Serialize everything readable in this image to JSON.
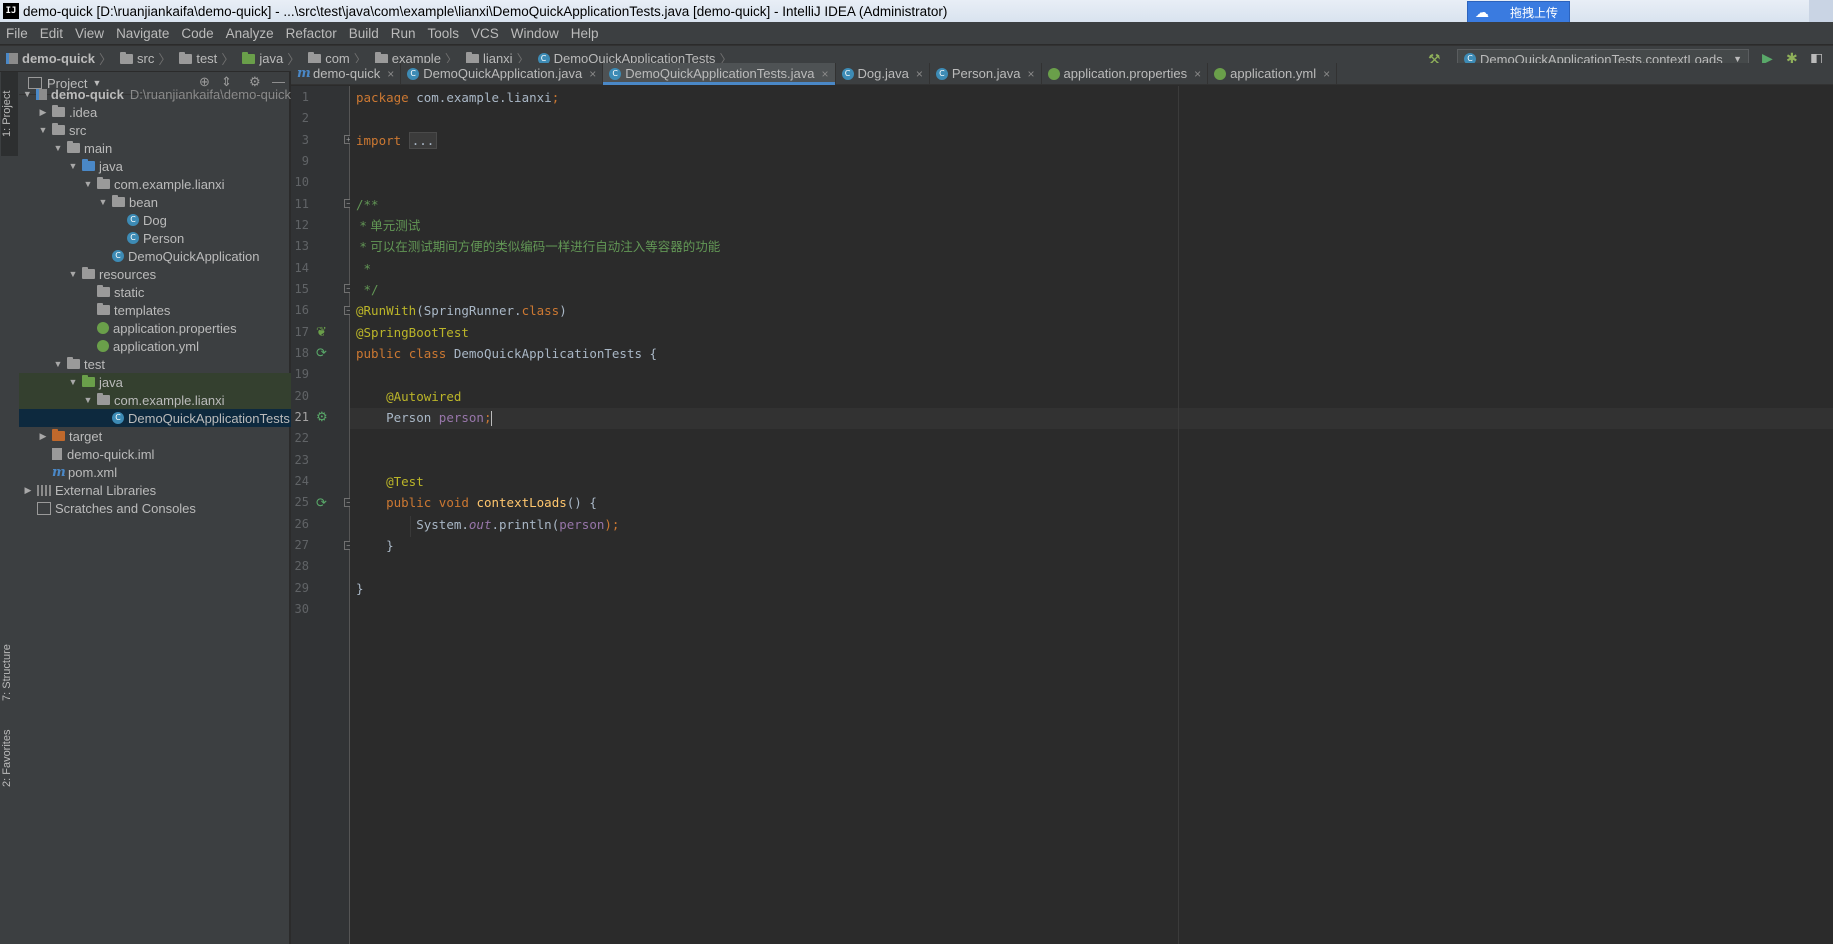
{
  "window": {
    "title": "demo-quick [D:\\ruanjiankaifa\\demo-quick] - ...\\src\\test\\java\\com\\example\\lianxi\\DemoQuickApplicationTests.java [demo-quick] - IntelliJ IDEA (Administrator)",
    "app_icon": "IJ",
    "upload_button": "拖拽上传"
  },
  "menu": [
    "File",
    "Edit",
    "View",
    "Navigate",
    "Code",
    "Analyze",
    "Refactor",
    "Build",
    "Run",
    "Tools",
    "VCS",
    "Window",
    "Help"
  ],
  "breadcrumb": [
    "demo-quick",
    "src",
    "test",
    "java",
    "com",
    "example",
    "lianxi",
    "DemoQuickApplicationTests"
  ],
  "run_config": "DemoQuickApplicationTests.contextLoads",
  "side_tabs": {
    "project": "1: Project",
    "structure": "7: Structure",
    "favorites": "2: Favorites"
  },
  "project_panel": {
    "title": "Project",
    "tree": [
      {
        "label": "demo-quick",
        "hint": "D:\\ruanjiankaifa\\demo-quick"
      },
      {
        "label": ".idea"
      },
      {
        "label": "src"
      },
      {
        "label": "main"
      },
      {
        "label": "java"
      },
      {
        "label": "com.example.lianxi"
      },
      {
        "label": "bean"
      },
      {
        "label": "Dog"
      },
      {
        "label": "Person"
      },
      {
        "label": "DemoQuickApplication"
      },
      {
        "label": "resources"
      },
      {
        "label": "static"
      },
      {
        "label": "templates"
      },
      {
        "label": "application.properties"
      },
      {
        "label": "application.yml"
      },
      {
        "label": "test"
      },
      {
        "label": "java"
      },
      {
        "label": "com.example.lianxi"
      },
      {
        "label": "DemoQuickApplicationTests"
      },
      {
        "label": "target"
      },
      {
        "label": "demo-quick.iml"
      },
      {
        "label": "pom.xml"
      },
      {
        "label": "External Libraries"
      },
      {
        "label": "Scratches and Consoles"
      }
    ]
  },
  "tabs": [
    {
      "label": "demo-quick",
      "active": false
    },
    {
      "label": "DemoQuickApplication.java",
      "active": false
    },
    {
      "label": "DemoQuickApplicationTests.java",
      "active": true
    },
    {
      "label": "Dog.java",
      "active": false
    },
    {
      "label": "Person.java",
      "active": false
    },
    {
      "label": "application.properties",
      "active": false
    },
    {
      "label": "application.yml",
      "active": false
    }
  ],
  "tab_close_glyph": "×",
  "code": {
    "line_numbers": [
      "1",
      "2",
      "3",
      "9",
      "10",
      "11",
      "12",
      "13",
      "14",
      "15",
      "16",
      "17",
      "18",
      "19",
      "20",
      "21",
      "22",
      "23",
      "24",
      "25",
      "26",
      "27",
      "28",
      "29",
      "30"
    ],
    "pkg_kw": "package",
    "pkg_name": " com.example.lianxi",
    "semi": ";",
    "import_kw": "import",
    "import_folded": "...",
    "doc_open": "/**",
    "doc_line1": " * 单元测试",
    "doc_line2": " * 可以在测试期间方便的类似编码一样进行自动注入等容器的功能",
    "doc_star": " *",
    "doc_close": " */",
    "runwith_ann": "@RunWith",
    "runwith_arg_open": "(SpringRunner.",
    "class_kw": "class",
    "paren_close": ")",
    "springboot_ann": "@SpringBootTest",
    "public_kw": "public",
    "class_kw2": "class",
    "class_name": " DemoQuickApplicationTests {",
    "autowired_ann": "@Autowired",
    "field_type": "Person ",
    "field_name": "person",
    "test_ann": "@Test",
    "public_kw2": "public",
    "void_kw": "void",
    "method_name": "contextLoads",
    "method_sig_end": "() {",
    "sys_out_start": "System.",
    "sys_out_field": "out",
    "println": ".println(",
    "println_arg": "person",
    "println_end": ");",
    "brace_close_inner": "}",
    "brace_close_outer": "}"
  }
}
